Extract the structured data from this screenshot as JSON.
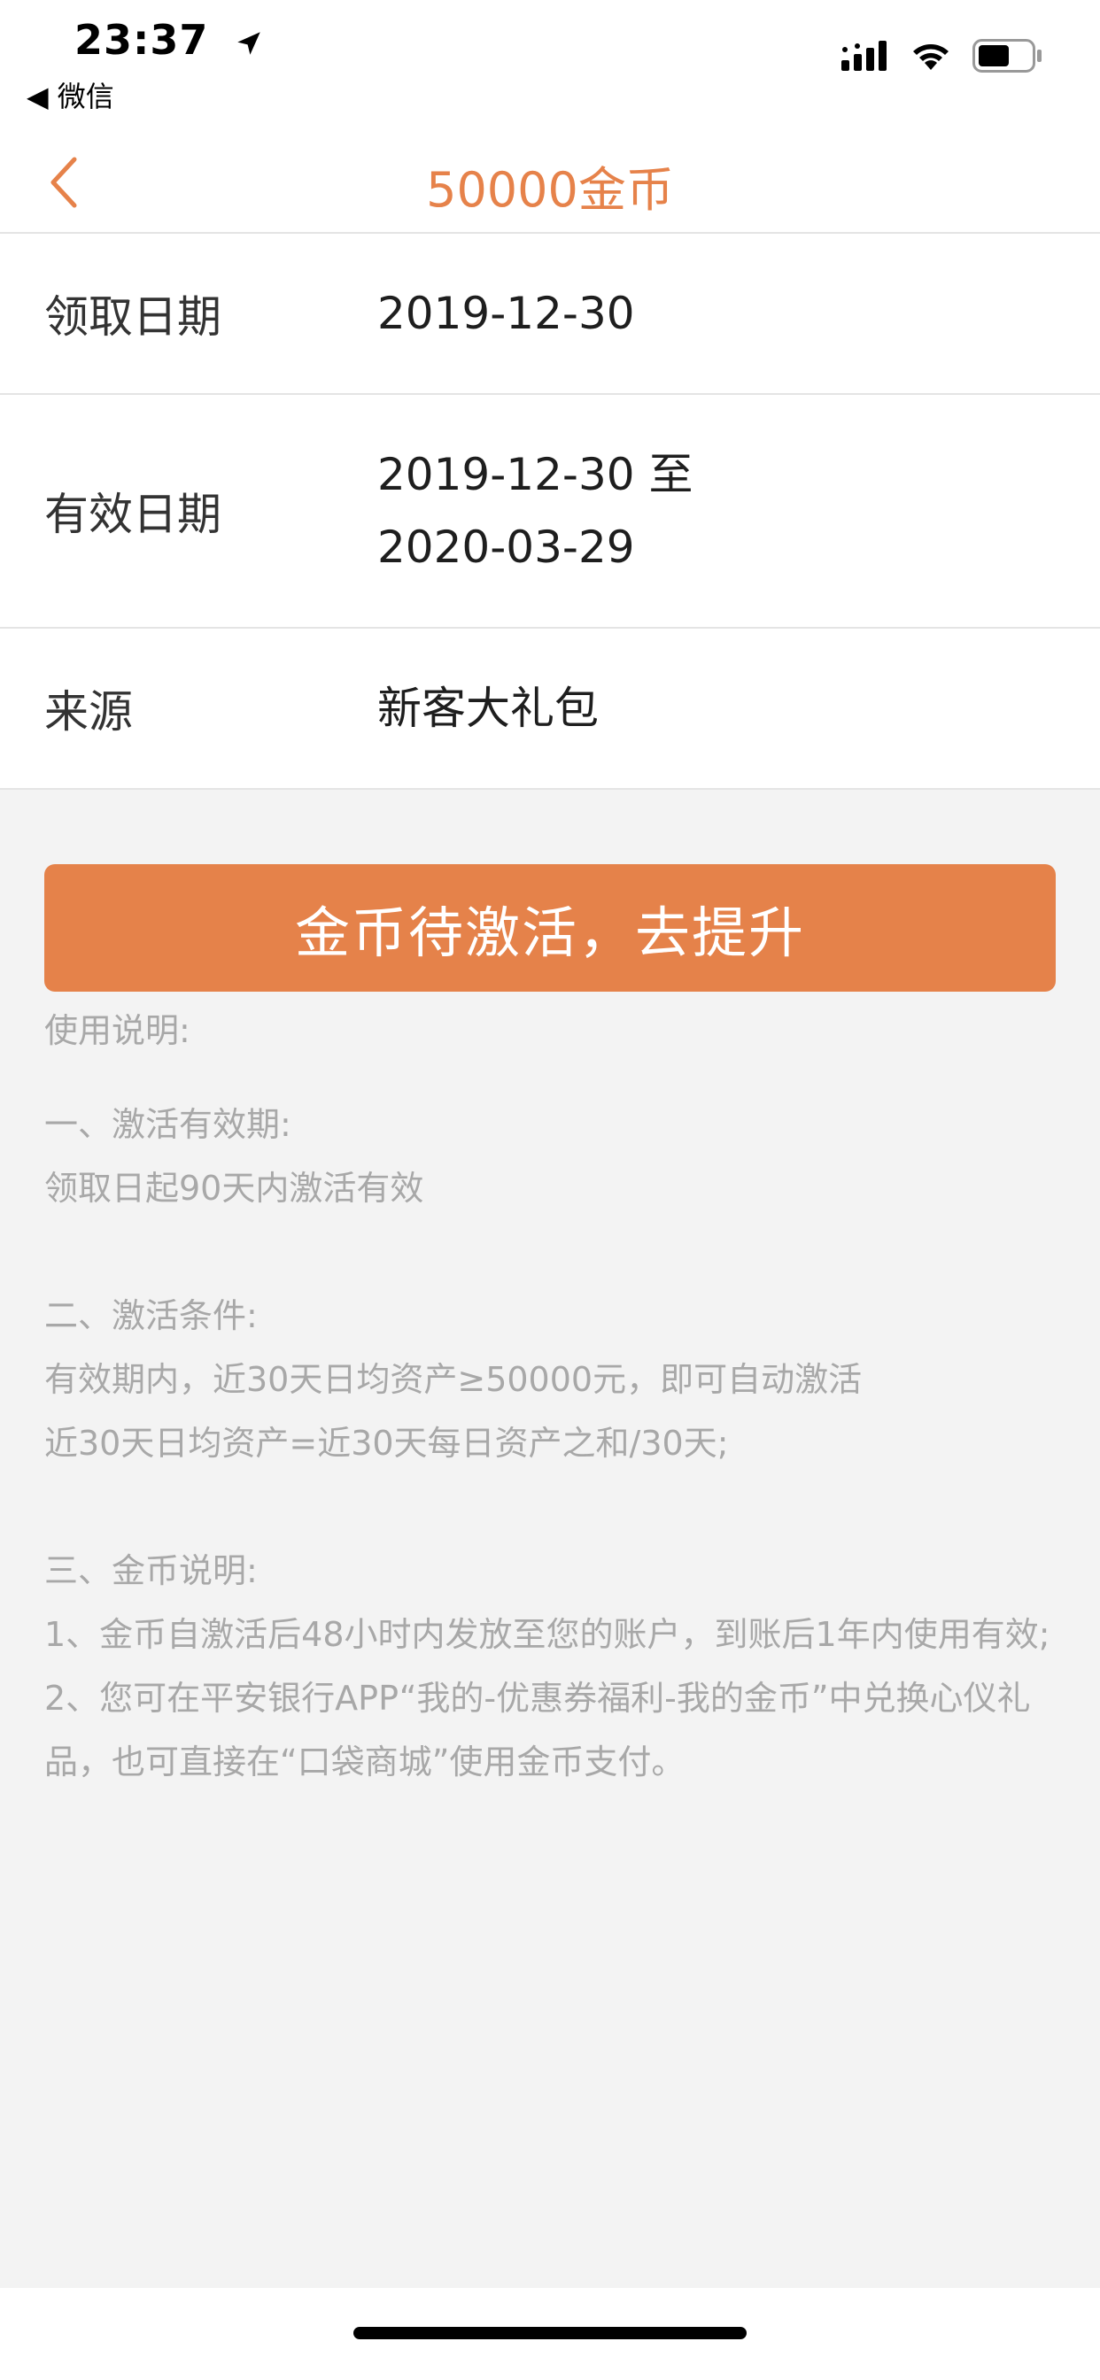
{
  "status_bar": {
    "time": "23:37",
    "back_app": "◀ 微信"
  },
  "nav": {
    "title": "50000金币"
  },
  "info": {
    "claim_date_label": "领取日期",
    "claim_date_value": "2019-12-30",
    "valid_date_label": "有效日期",
    "valid_date_value_line1": "2019-12-30 至",
    "valid_date_value_line2": "2020-03-29",
    "source_label": "来源",
    "source_value": "新客大礼包"
  },
  "action": {
    "button_label": "金币待激活，去提升"
  },
  "instructions": {
    "heading": "使用说明:",
    "section1_title": "一、激活有效期:",
    "section1_line1": "领取日起90天内激活有效",
    "section2_title": "二、激活条件:",
    "section2_line1": "有效期内，近30天日均资产≥50000元，即可自动激活",
    "section2_line2": "近30天日均资产=近30天每日资产之和/30天;",
    "section3_title": "三、金币说明:",
    "section3_line1": "1、金币自激活后48小时内发放至您的账户，到账后1年内使用有效;",
    "section3_line2": "2、您可在平安银行APP“我的-优惠券福利-我的金币”中兑换心仪礼品，也可直接在“口袋商城”使用金币支付。"
  },
  "colors": {
    "accent": "#e5824a",
    "background": "#f3f3f3",
    "muted_text": "#a8a8a8"
  }
}
